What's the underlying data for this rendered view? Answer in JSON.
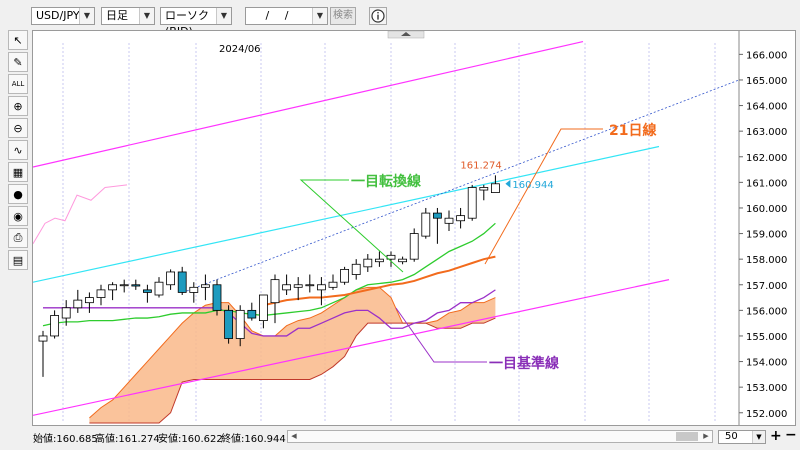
{
  "toolbar": {
    "symbol": "USD/JPY",
    "timeframe": "日足",
    "chart_kind": "ローソク(BID)",
    "date_value": "/ /",
    "search_label": "検索",
    "info_icon": "info-icon"
  },
  "sidebar": {
    "tools": [
      {
        "name": "cursor-icon",
        "glyph": "↖"
      },
      {
        "name": "pencil-icon",
        "glyph": "✎"
      },
      {
        "name": "all-icon",
        "glyph": "ALL"
      },
      {
        "name": "zoom-in-icon",
        "glyph": "⊕"
      },
      {
        "name": "zoom-out-icon",
        "glyph": "⊖"
      },
      {
        "name": "chart-indicator-icon",
        "glyph": "∿"
      },
      {
        "name": "oscillator-icon",
        "glyph": "▦"
      },
      {
        "name": "palette-icon",
        "glyph": "●"
      },
      {
        "name": "eye-icon",
        "glyph": "◉"
      },
      {
        "name": "print-icon",
        "glyph": "⎙"
      },
      {
        "name": "grid-icon",
        "glyph": "▤"
      }
    ]
  },
  "chart": {
    "date_label": "2024/06",
    "price_axis": [
      "166.000",
      "165.000",
      "164.000",
      "163.000",
      "162.000",
      "161.000",
      "160.000",
      "159.000",
      "158.000",
      "157.000",
      "156.000",
      "155.000",
      "154.000",
      "153.000",
      "152.000"
    ],
    "high_label": "161.274",
    "close_label": "160.944",
    "ann_tenkan": "一目転換線",
    "ann_ma21": "21日線",
    "ann_kijun": "一目基準線",
    "colors": {
      "ma21": "#f26b1d",
      "tenkan": "#2ecc2e",
      "kijun": "#9b30c8",
      "cloud": "#f9b88a",
      "cloud_edge": "#c0392b",
      "channel": "#ff33ff",
      "cyan_line": "#33e5f5",
      "bear": "#1e9bbf",
      "last_price": "#22a7d9"
    }
  },
  "chart_data": {
    "type": "candlestick",
    "symbol": "USD/JPY",
    "x_label_top": "2024/06",
    "ylim": [
      151.6,
      166.6
    ],
    "ohlc": [
      {
        "o": 154.8,
        "h": 155.2,
        "l": 153.4,
        "c": 155.0
      },
      {
        "o": 155.0,
        "h": 156.0,
        "l": 154.9,
        "c": 155.8
      },
      {
        "o": 155.7,
        "h": 156.4,
        "l": 155.4,
        "c": 156.1
      },
      {
        "o": 156.1,
        "h": 156.8,
        "l": 155.9,
        "c": 156.4
      },
      {
        "o": 156.3,
        "h": 156.7,
        "l": 155.9,
        "c": 156.5
      },
      {
        "o": 156.5,
        "h": 157.0,
        "l": 156.2,
        "c": 156.8
      },
      {
        "o": 156.8,
        "h": 157.1,
        "l": 156.4,
        "c": 157.0
      },
      {
        "o": 157.0,
        "h": 157.2,
        "l": 156.7,
        "c": 157.0
      },
      {
        "o": 157.0,
        "h": 157.2,
        "l": 156.8,
        "c": 156.95
      },
      {
        "o": 156.8,
        "h": 157.0,
        "l": 156.3,
        "c": 156.7
      },
      {
        "o": 156.6,
        "h": 157.3,
        "l": 156.5,
        "c": 157.1
      },
      {
        "o": 157.0,
        "h": 157.6,
        "l": 156.8,
        "c": 157.5
      },
      {
        "o": 157.5,
        "h": 157.7,
        "l": 156.6,
        "c": 156.7
      },
      {
        "o": 156.7,
        "h": 157.1,
        "l": 156.3,
        "c": 156.9
      },
      {
        "o": 156.9,
        "h": 157.4,
        "l": 156.4,
        "c": 157.0
      },
      {
        "o": 157.0,
        "h": 157.2,
        "l": 155.8,
        "c": 156.0
      },
      {
        "o": 156.0,
        "h": 156.2,
        "l": 154.7,
        "c": 154.9
      },
      {
        "o": 154.9,
        "h": 156.2,
        "l": 154.6,
        "c": 156.0
      },
      {
        "o": 156.0,
        "h": 156.3,
        "l": 155.6,
        "c": 155.7
      },
      {
        "o": 155.6,
        "h": 156.6,
        "l": 155.3,
        "c": 156.6
      },
      {
        "o": 156.3,
        "h": 157.4,
        "l": 155.5,
        "c": 157.2
      },
      {
        "o": 156.8,
        "h": 157.4,
        "l": 156.6,
        "c": 157.0
      },
      {
        "o": 156.9,
        "h": 157.3,
        "l": 156.4,
        "c": 157.0
      },
      {
        "o": 157.0,
        "h": 157.4,
        "l": 156.7,
        "c": 157.0
      },
      {
        "o": 156.8,
        "h": 157.3,
        "l": 156.2,
        "c": 157.0
      },
      {
        "o": 156.9,
        "h": 157.4,
        "l": 156.8,
        "c": 157.1
      },
      {
        "o": 157.1,
        "h": 157.7,
        "l": 157.0,
        "c": 157.6
      },
      {
        "o": 157.4,
        "h": 158.0,
        "l": 157.2,
        "c": 157.8
      },
      {
        "o": 157.7,
        "h": 158.2,
        "l": 157.5,
        "c": 158.0
      },
      {
        "o": 157.9,
        "h": 158.3,
        "l": 157.7,
        "c": 158.0
      },
      {
        "o": 158.0,
        "h": 158.3,
        "l": 157.7,
        "c": 158.15
      },
      {
        "o": 157.9,
        "h": 158.1,
        "l": 157.8,
        "c": 158.0
      },
      {
        "o": 158.0,
        "h": 159.2,
        "l": 157.9,
        "c": 159.0
      },
      {
        "o": 158.9,
        "h": 160.0,
        "l": 158.8,
        "c": 159.8
      },
      {
        "o": 159.8,
        "h": 160.0,
        "l": 158.6,
        "c": 159.6
      },
      {
        "o": 159.4,
        "h": 159.9,
        "l": 159.1,
        "c": 159.6
      },
      {
        "o": 159.5,
        "h": 160.0,
        "l": 159.2,
        "c": 159.7
      },
      {
        "o": 159.6,
        "h": 160.9,
        "l": 159.5,
        "c": 160.8
      },
      {
        "o": 160.7,
        "h": 160.9,
        "l": 160.3,
        "c": 160.8
      },
      {
        "o": 160.6,
        "h": 161.274,
        "l": 160.622,
        "c": 160.944
      }
    ],
    "ma21": [
      null,
      null,
      null,
      null,
      null,
      null,
      null,
      null,
      null,
      null,
      null,
      null,
      null,
      null,
      null,
      null,
      null,
      null,
      null,
      156.2,
      156.3,
      156.4,
      156.45,
      156.5,
      156.5,
      156.55,
      156.6,
      156.7,
      156.8,
      156.9,
      157.0,
      157.05,
      157.15,
      157.3,
      157.45,
      157.55,
      157.7,
      157.85,
      158.0,
      158.1
    ],
    "tenkan": [
      155.4,
      155.5,
      155.55,
      155.55,
      155.6,
      155.6,
      155.6,
      155.65,
      155.7,
      155.7,
      155.75,
      155.85,
      155.9,
      155.9,
      155.9,
      156.0,
      156.0,
      155.9,
      155.85,
      155.8,
      155.85,
      155.9,
      155.95,
      156.0,
      156.1,
      156.3,
      156.5,
      156.8,
      157.0,
      157.05,
      157.1,
      157.2,
      157.4,
      157.7,
      158.0,
      158.3,
      158.5,
      158.7,
      159.0,
      159.4
    ],
    "kijun": [
      156.1,
      156.1,
      156.1,
      156.1,
      156.1,
      156.1,
      156.1,
      156.1,
      156.1,
      156.1,
      156.1,
      156.1,
      156.1,
      156.1,
      156.1,
      156.1,
      155.9,
      155.5,
      155.1,
      155.0,
      155.0,
      155.0,
      155.3,
      155.3,
      155.5,
      155.7,
      155.9,
      156.0,
      156.0,
      155.7,
      155.3,
      155.3,
      155.5,
      155.6,
      155.9,
      156.0,
      156.3,
      156.3,
      156.5,
      156.8
    ],
    "cloud_upper": [
      151.8,
      152.2,
      152.5,
      153.0,
      153.5,
      154.0,
      154.5,
      155.0,
      155.5,
      155.9,
      156.2,
      156.3,
      156.3,
      155.8,
      155.2,
      155.0,
      155.0,
      155.4,
      155.6,
      155.7,
      155.9,
      156.2,
      156.5,
      156.8,
      156.9,
      156.9,
      156.5,
      155.5,
      155.5,
      155.5,
      155.6,
      155.9,
      156.0,
      156.3,
      156.3,
      156.5
    ],
    "cloud_lower": [
      151.6,
      151.6,
      151.6,
      151.6,
      151.6,
      151.6,
      151.6,
      152.0,
      153.2,
      153.3,
      153.3,
      153.3,
      153.3,
      153.3,
      153.3,
      153.3,
      153.3,
      153.3,
      153.3,
      153.3,
      153.5,
      153.8,
      154.2,
      155.0,
      155.5,
      155.5,
      155.5,
      155.5,
      155.5,
      155.5,
      155.3,
      155.3,
      155.3,
      155.5,
      155.5,
      155.7
    ],
    "last_high": 161.274,
    "last_close": 160.944,
    "legend": [
      "一目転換線",
      "21日線",
      "一目基準線"
    ]
  },
  "status": {
    "open": "始値:160.685",
    "high": "高値:161.274",
    "low": "安値:160.622",
    "close": "終値:160.944",
    "bars": "50"
  }
}
